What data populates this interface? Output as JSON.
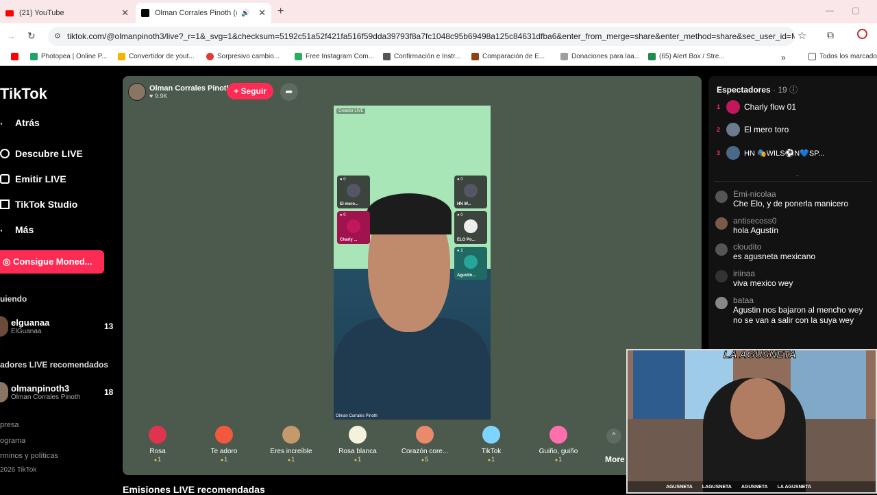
{
  "browser": {
    "tabs": [
      {
        "label": "(21) YouTube"
      },
      {
        "label": "Olman Corrales Pinoth (@o"
      }
    ],
    "url": "tiktok.com/@olmanpinoth3/live?_r=1&_svg=1&checksum=5192c51a52f421fa516f59dda39793f8a7fc1048c95b69498a125c84631dfba6&enter_from_merge=share&enter_method=share&sec_user_id=MS...",
    "bookmarks": [
      "Photopea | Online P...",
      "Convertidor de yout...",
      "Sorpresivo cambio...",
      "Free Instagram Com...",
      "Confirmación e Instr...",
      "Comparación de E...",
      "Donaciones para laa...",
      "(65) Alert Box / Stre...",
      "Todos los marcado"
    ],
    "bookmark_colors": [
      "#21a366",
      "#f5b400",
      "#e53935",
      "#27ae60",
      "#555555",
      "#8b4513",
      "#9e9e9e",
      "#1f8b4c"
    ]
  },
  "nav": {
    "logo": "TikTok",
    "back": "Atrás",
    "discover": "Descubre LIVE",
    "go_live": "Emitir LIVE",
    "studio": "TikTok Studio",
    "more": "Más",
    "coins": "Consigue Moned...",
    "following_head": "uiendo",
    "following": [
      {
        "name": "elguanaa",
        "sub": "ElGuanaa",
        "count": "13"
      }
    ],
    "recommended_head": "adores LIVE recomendados",
    "recommended": [
      {
        "name": "olmanpinoth3",
        "sub": "Olman Corrales Pinoth",
        "count": "18"
      }
    ],
    "footer": [
      "presa",
      "ograma",
      "rminos y políticas",
      "2026 TikTok"
    ]
  },
  "stage": {
    "host_name": "Olman Corrales Pinoth",
    "host_likes": "♥ 9.9K",
    "follow": "+ Seguir",
    "creator_tag": "Creador LIVE",
    "video_footer": "Olman Corrales Pinoth",
    "guests": [
      {
        "top": "● 0",
        "label": "El mero..."
      },
      {
        "top": "● 0",
        "label": "Charly ..."
      },
      {
        "top": "● 0",
        "label": "HN W..."
      },
      {
        "top": "● 0",
        "label": "ELO Po..."
      },
      {
        "top": "● 2",
        "label": "Agustin..."
      }
    ],
    "gifts": [
      {
        "name": "Rosa",
        "price": "1",
        "color": "#e0334f"
      },
      {
        "name": "Te adoro",
        "price": "1",
        "color": "#f2583e"
      },
      {
        "name": "Eres increíble",
        "price": "1",
        "color": "#c49a6c"
      },
      {
        "name": "Rosa blanca",
        "price": "1",
        "color": "#f4f1dc"
      },
      {
        "name": "Corazón core...",
        "price": "5",
        "color": "#e98a6b"
      },
      {
        "name": "TikTok",
        "price": "1",
        "color": "#7fd4ff"
      },
      {
        "name": "Guiño, guiño",
        "price": "1",
        "color": "#ff6fae"
      }
    ],
    "more": "More"
  },
  "recommended_title": "Emisiones LIVE recomendadas",
  "right": {
    "viewers_title": "Espectadores",
    "viewers_count": "· 19",
    "viewers": [
      {
        "rank": "1",
        "name": "Charly flow 01",
        "color": "#c2185b"
      },
      {
        "rank": "2",
        "name": "El mero toro",
        "color": "#6d7b8d"
      },
      {
        "rank": "3",
        "name": "HN 🎭WILS⚽N💙SP...",
        "color": "#4a6a8a"
      }
    ],
    "chat": [
      {
        "user": "Emi-nicolaa",
        "msg": "Che Elo, y de ponerla manicero"
      },
      {
        "user": "antisecoss0",
        "msg": "hola Agustín"
      },
      {
        "user": "cloudito",
        "msg": "es agusneta mexicano"
      },
      {
        "user": "iriinaa",
        "msg": "viva mexico wey"
      },
      {
        "user": "bataa",
        "msg": "Agustin nos bajaron al mencho wey no se van a salir con la suya wey"
      }
    ]
  },
  "webcam": {
    "logo": "LA AGUSNETA",
    "social": [
      "AGUSNETA",
      "LAGUSNETA",
      "AGUSNETA",
      "LA AGUSNETA"
    ]
  }
}
